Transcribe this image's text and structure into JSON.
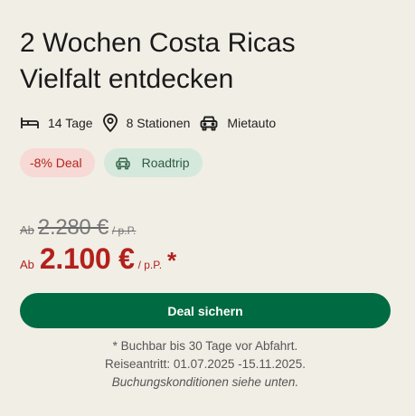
{
  "title": {
    "line1": "2 Wochen Costa Ricas",
    "line2": "Vielfalt entdecken"
  },
  "features": [
    {
      "icon": "bed-icon",
      "label": "14 Tage"
    },
    {
      "icon": "location-pin-icon",
      "label": "8 Stationen"
    },
    {
      "icon": "car-icon",
      "label": "Mietauto"
    }
  ],
  "badges": {
    "deal": "-8% Deal",
    "trip": {
      "icon": "car-icon",
      "label": "Roadtrip"
    }
  },
  "price": {
    "old": {
      "prefix": "Ab",
      "amount": "2.280 €",
      "unit": "/ p.P."
    },
    "new": {
      "prefix": "Ab",
      "amount": "2.100 €",
      "unit": "/ p.P.",
      "asterisk": "*"
    }
  },
  "cta": {
    "label": "Deal sichern"
  },
  "notes": {
    "line1": "* Buchbar bis 30 Tage vor Abfahrt.",
    "line2": "Reiseantritt: 01.07.2025 -15.11.2025.",
    "line3": "Buchungskonditionen siehe unten."
  },
  "colors": {
    "background": "#f1eee6",
    "accent_green": "#006a42",
    "price_red": "#b3201c",
    "deal_badge_bg": "#f7d9d6",
    "trip_badge_bg": "#d5e8dc"
  }
}
